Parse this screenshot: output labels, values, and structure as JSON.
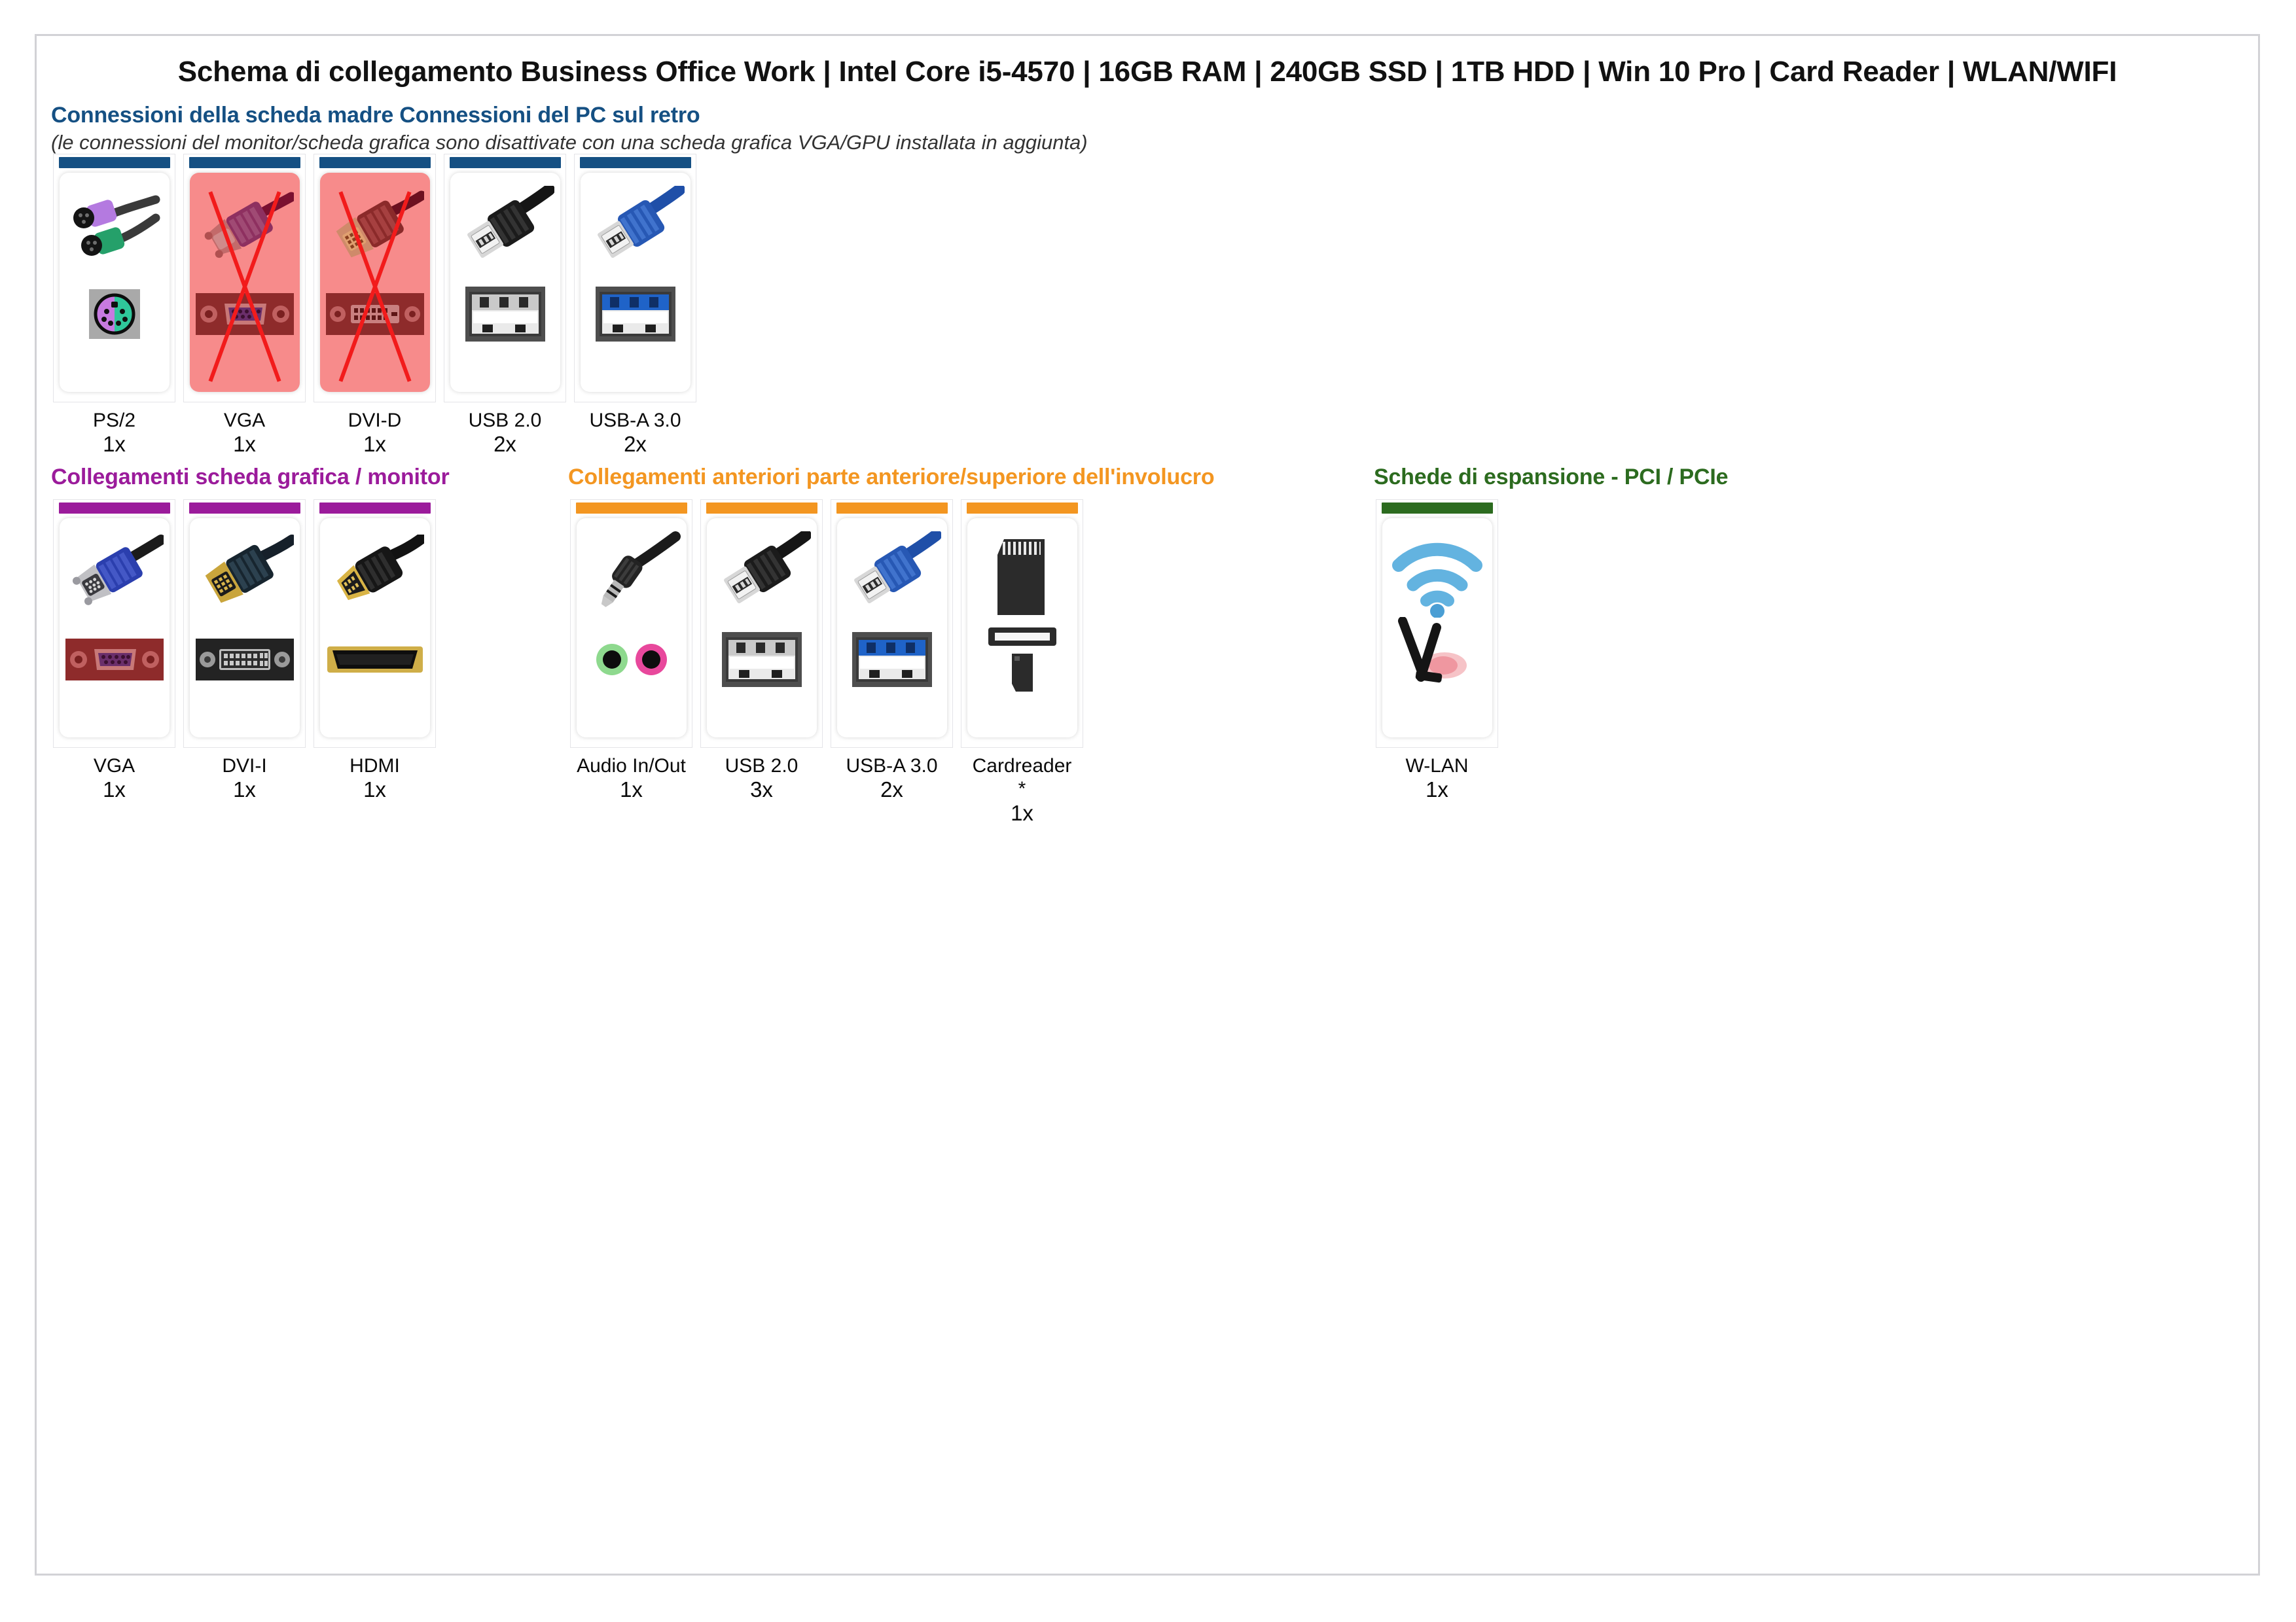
{
  "document": {
    "title": "Schema di collegamento Business Office Work | Intel Core i5-4570 | 16GB RAM | 240GB SSD | 1TB HDD | Win 10 Pro | Card Reader | WLAN/WIFI"
  },
  "colors": {
    "motherboard_accent": "#155083",
    "graphics_accent": "#9B1B9B",
    "front_accent": "#F39621",
    "expansion_accent": "#2C6B1F",
    "disabled_overlay": "#F78B8B",
    "cross_red": "#F21B1B",
    "frame_border": "#D2D2D6"
  },
  "sections": [
    {
      "id": "motherboard",
      "heading": "Connessioni della scheda madre Connessioni del PC sul retro",
      "heading_color": "#155083",
      "subheading": "(le connessioni del monitor/scheda grafica sono disattivate con una scheda grafica VGA/GPU installata in aggiunta)",
      "accent": "#155083",
      "cards": [
        {
          "name": "PS/2",
          "count": "1x",
          "star": "",
          "disabled": false,
          "plug": "ps2-plug-icon",
          "port": "ps2-port-icon"
        },
        {
          "name": "VGA",
          "count": "1x",
          "star": "",
          "disabled": true,
          "plug": "vga-plug-icon",
          "port": "vga-port-icon"
        },
        {
          "name": "DVI-D",
          "count": "1x",
          "star": "",
          "disabled": true,
          "plug": "dvi-plug-icon",
          "port": "dvid-port-icon"
        },
        {
          "name": "USB 2.0",
          "count": "2x",
          "star": "",
          "disabled": false,
          "plug": "usb2-plug-icon",
          "port": "usb2-port-icon"
        },
        {
          "name": "USB-A 3.0",
          "count": "2x",
          "star": "",
          "disabled": false,
          "plug": "usb3-plug-icon",
          "port": "usb3-port-icon"
        }
      ]
    },
    {
      "id": "graphics",
      "heading": "Collegamenti scheda grafica / monitor",
      "heading_color": "#9B1B9B",
      "accent": "#9B1B9B",
      "cards": [
        {
          "name": "VGA",
          "count": "1x",
          "star": "",
          "disabled": false,
          "plug": "vga-blue-plug-icon",
          "port": "vga-port-icon"
        },
        {
          "name": "DVI-I",
          "count": "1x",
          "star": "",
          "disabled": false,
          "plug": "dvii-plug-icon",
          "port": "dvii-port-icon"
        },
        {
          "name": "HDMI",
          "count": "1x",
          "star": "",
          "disabled": false,
          "plug": "hdmi-plug-icon",
          "port": "hdmi-port-icon"
        }
      ]
    },
    {
      "id": "front",
      "heading": "Collegamenti anteriori parte anteriore/superiore dell'involucro",
      "heading_color": "#F39621",
      "accent": "#F39621",
      "cards": [
        {
          "name": "Audio In/Out",
          "count": "1x",
          "star": "",
          "disabled": false,
          "plug": "audio-jack-plug-icon",
          "port": "audio-jacks-port-icon"
        },
        {
          "name": "USB 2.0",
          "count": "3x",
          "star": "",
          "disabled": false,
          "plug": "usb2-plug-icon",
          "port": "usb2-port-icon"
        },
        {
          "name": "USB-A 3.0",
          "count": "2x",
          "star": "",
          "disabled": false,
          "plug": "usb3-plug-icon",
          "port": "usb3-port-icon"
        },
        {
          "name": "Cardreader",
          "count": "1x",
          "star": "*",
          "disabled": false,
          "plug": "sd-card-icon",
          "port": "cardreader-slot-icon"
        }
      ]
    },
    {
      "id": "expansion",
      "heading": "Schede di espansione - PCI / PCIe",
      "heading_color": "#2C6B1F",
      "accent": "#2C6B1F",
      "cards": [
        {
          "name": "W-LAN",
          "count": "1x",
          "star": "",
          "disabled": false,
          "plug": "wifi-signal-icon",
          "port": "wifi-antenna-card-icon"
        }
      ]
    }
  ]
}
